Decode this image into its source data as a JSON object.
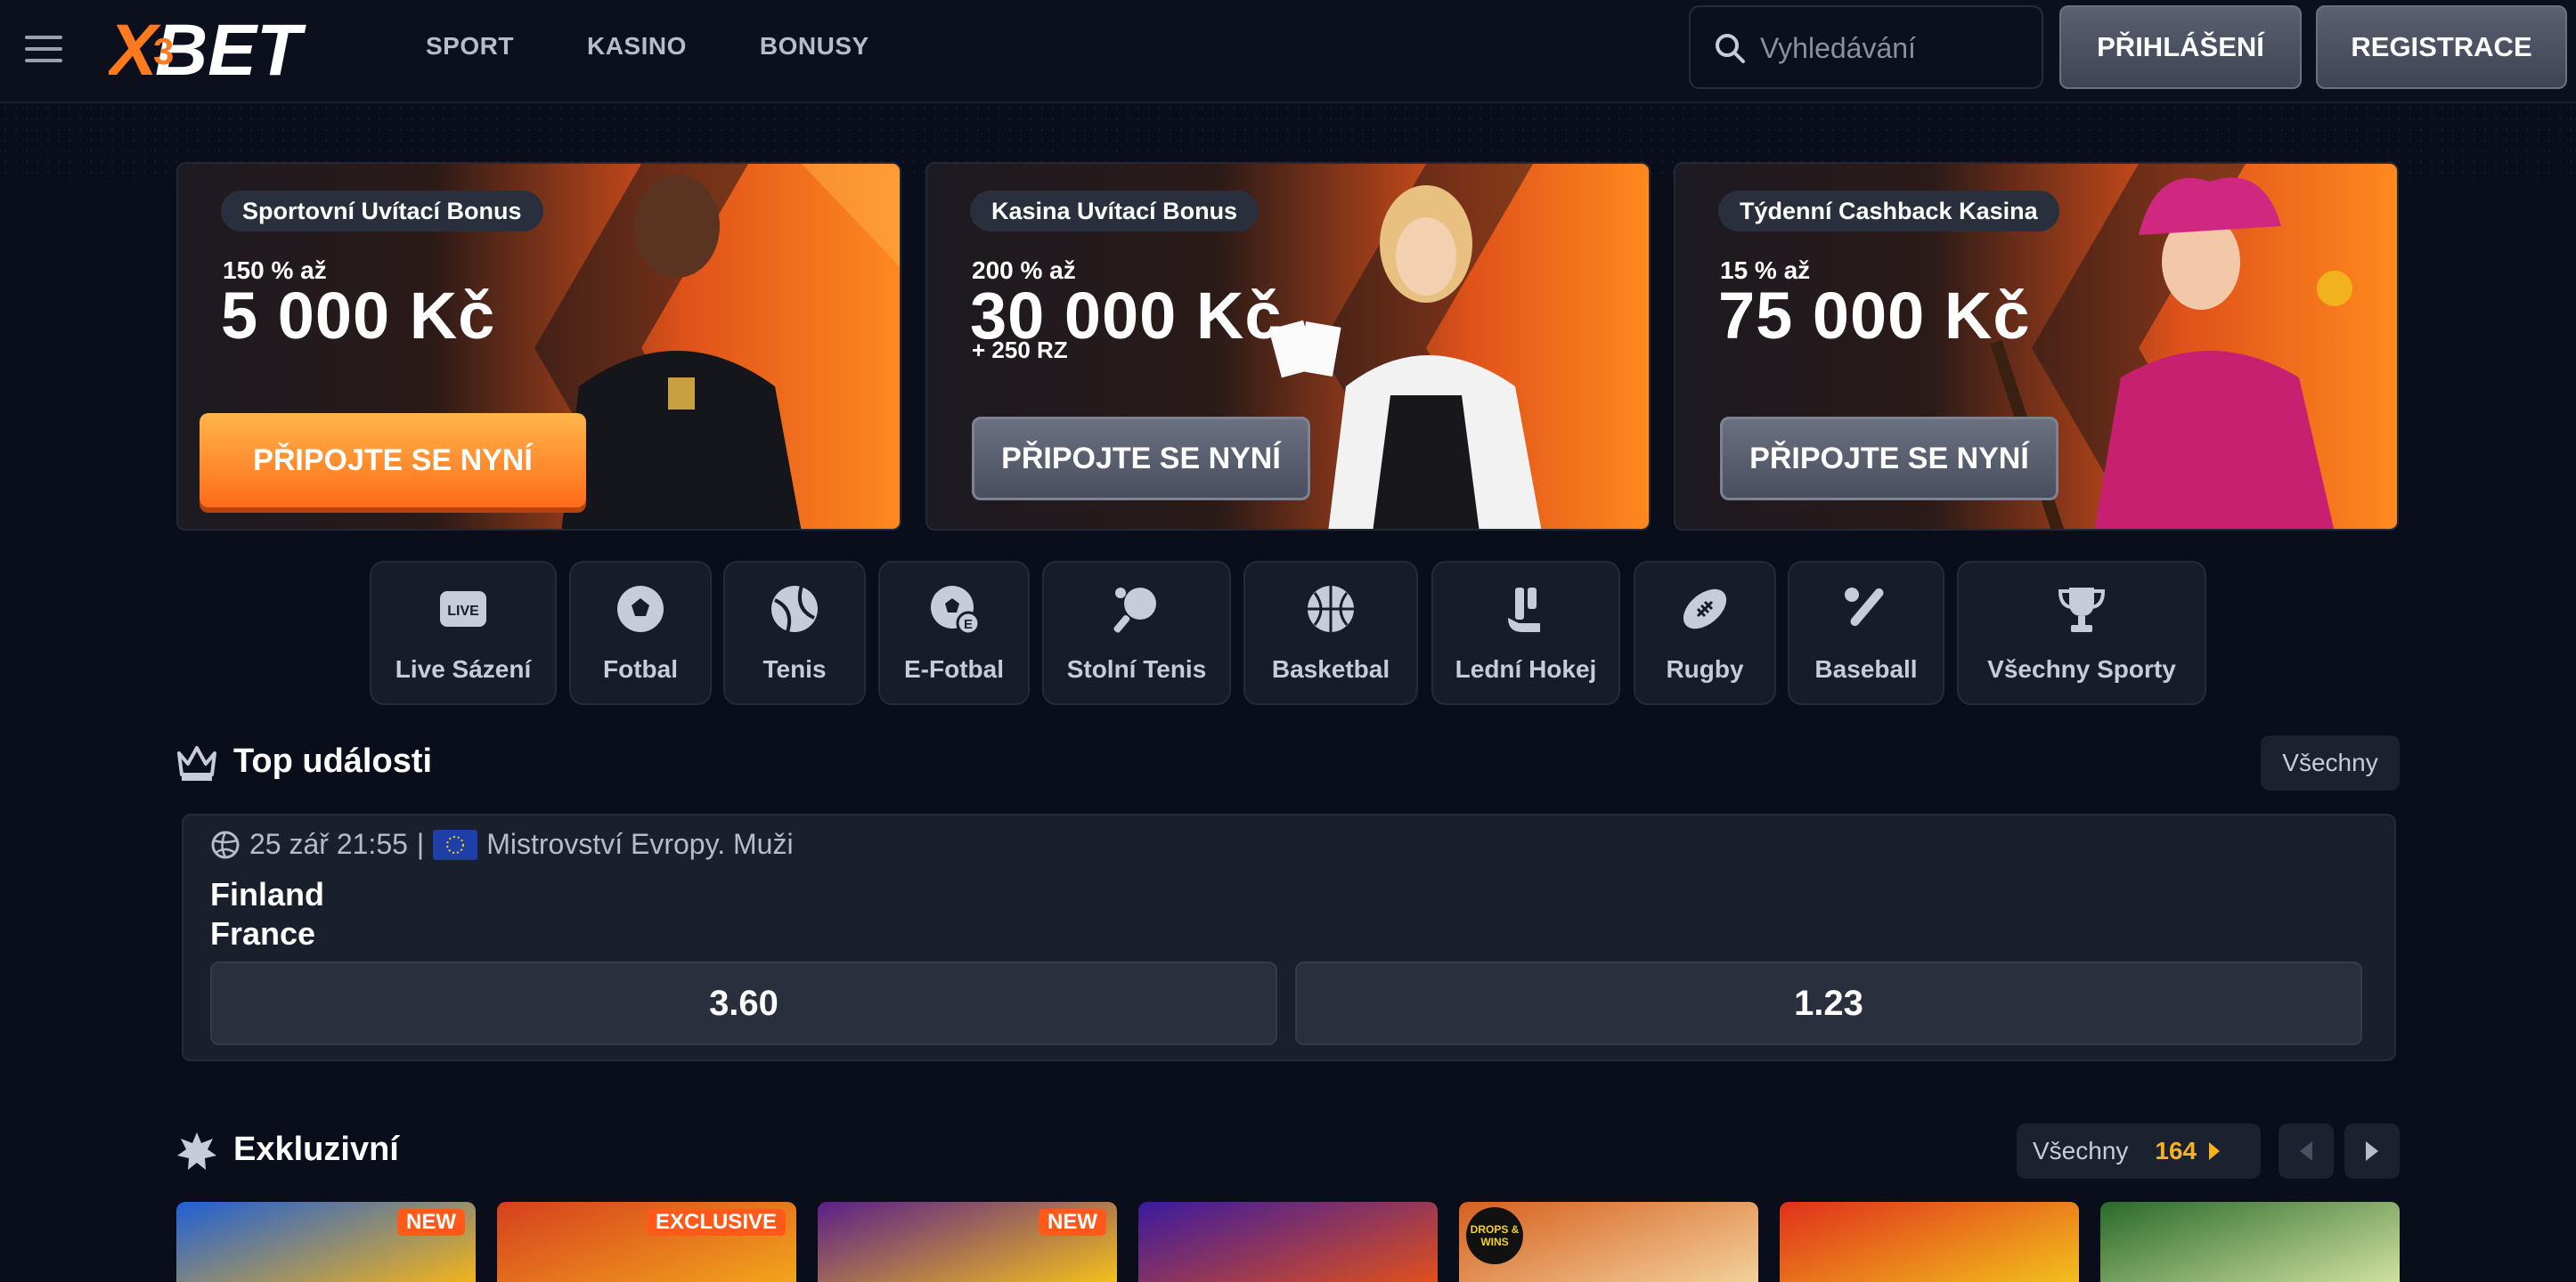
{
  "header": {
    "logo_text": "XBET",
    "nav": [
      "SPORT",
      "KASINO",
      "BONUSY"
    ],
    "search_placeholder": "Vyhledávání",
    "login_label": "PŘIHLÁŠENÍ",
    "register_label": "REGISTRACE"
  },
  "banners": [
    {
      "tag": "Sportovní Uvítací Bonus",
      "percent": "150 % až",
      "amount": "5 000 Kč",
      "extra": "",
      "cta": "PŘIPOJTE SE NYNÍ"
    },
    {
      "tag": "Kasina Uvítací Bonus",
      "percent": "200 % až",
      "amount": "30 000 Kč",
      "extra": "+ 250 RZ",
      "cta": "PŘIPOJTE SE NYNÍ"
    },
    {
      "tag": "Týdenní Cashback Kasina",
      "percent": "15 % až",
      "amount": "75 000 Kč",
      "extra": "",
      "cta": "PŘIPOJTE SE NYNÍ"
    }
  ],
  "sports": [
    {
      "label": "Live Sázení",
      "icon": "live-icon"
    },
    {
      "label": "Fotbal",
      "icon": "soccer-ball-icon"
    },
    {
      "label": "Tenis",
      "icon": "tennis-ball-icon"
    },
    {
      "label": "E-Fotbal",
      "icon": "esoccer-icon"
    },
    {
      "label": "Stolní Tenis",
      "icon": "table-tennis-icon"
    },
    {
      "label": "Basketbal",
      "icon": "basketball-icon"
    },
    {
      "label": "Lední Hokej",
      "icon": "ice-hockey-icon"
    },
    {
      "label": "Rugby",
      "icon": "rugby-ball-icon"
    },
    {
      "label": "Baseball",
      "icon": "baseball-icon"
    },
    {
      "label": "Všechny Sporty",
      "icon": "trophy-icon"
    }
  ],
  "top_events": {
    "title": "Top události",
    "all_label": "Všechny",
    "event": {
      "datetime": "25 zář 21:55",
      "separator": "|",
      "league": "Mistrovství Evropy. Muži",
      "team1": "Finland",
      "team2": "France",
      "odds": [
        "3.60",
        "1.23"
      ]
    }
  },
  "exclusive": {
    "title": "Exkluzivní",
    "all_label": "Všechny",
    "count": "164",
    "games": [
      {
        "badge": "NEW",
        "color1": "#1f5fd6",
        "color2": "#f2b31c"
      },
      {
        "badge": "EXCLUSIVE",
        "color1": "#d6401f",
        "color2": "#f2a51c"
      },
      {
        "badge": "NEW",
        "color1": "#5a1f8a",
        "color2": "#f2c01c"
      },
      {
        "badge": "",
        "color1": "#3a1aa0",
        "color2": "#e0501c"
      },
      {
        "badge": "",
        "color1": "#d6601f",
        "color2": "#f2d09c"
      },
      {
        "badge": "",
        "color1": "#e0301c",
        "color2": "#f2c01c"
      },
      {
        "badge": "",
        "color1": "#2a6a2a",
        "color2": "#d0e0a0"
      }
    ],
    "drops_text": "DROPS & WINS"
  },
  "colors": {
    "accent": "#ff6a1a",
    "gold": "#f5b21e",
    "bg": "#0a0e1a"
  }
}
